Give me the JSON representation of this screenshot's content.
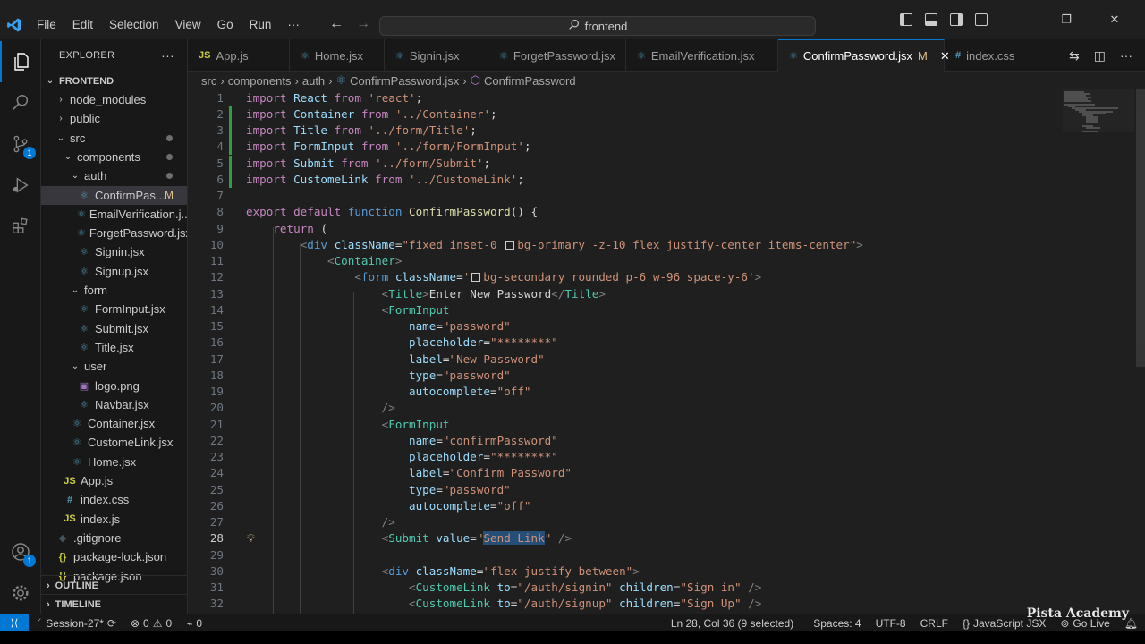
{
  "menu": [
    "File",
    "Edit",
    "Selection",
    "View",
    "Go",
    "Run",
    "···"
  ],
  "command_center": "frontend",
  "explorer": {
    "header": "EXPLORER",
    "more": "···",
    "root": "FRONTEND",
    "items": [
      {
        "label": "node_modules",
        "depth": 1,
        "kind": "folder-closed"
      },
      {
        "label": "public",
        "depth": 1,
        "kind": "folder-closed"
      },
      {
        "label": "src",
        "depth": 1,
        "kind": "folder-open",
        "dot": true
      },
      {
        "label": "components",
        "depth": 2,
        "kind": "folder-open",
        "dot": true
      },
      {
        "label": "auth",
        "depth": 3,
        "kind": "folder-open",
        "dot": true
      },
      {
        "label": "ConfirmPas...",
        "depth": 4,
        "kind": "react",
        "selected": true,
        "status": "M"
      },
      {
        "label": "EmailVerification.j...",
        "depth": 4,
        "kind": "react"
      },
      {
        "label": "ForgetPassword.jsx",
        "depth": 4,
        "kind": "react"
      },
      {
        "label": "Signin.jsx",
        "depth": 4,
        "kind": "react"
      },
      {
        "label": "Signup.jsx",
        "depth": 4,
        "kind": "react"
      },
      {
        "label": "form",
        "depth": 3,
        "kind": "folder-open"
      },
      {
        "label": "FormInput.jsx",
        "depth": 4,
        "kind": "react"
      },
      {
        "label": "Submit.jsx",
        "depth": 4,
        "kind": "react"
      },
      {
        "label": "Title.jsx",
        "depth": 4,
        "kind": "react"
      },
      {
        "label": "user",
        "depth": 3,
        "kind": "folder-open"
      },
      {
        "label": "logo.png",
        "depth": 4,
        "kind": "image"
      },
      {
        "label": "Navbar.jsx",
        "depth": 4,
        "kind": "react"
      },
      {
        "label": "Container.jsx",
        "depth": 3,
        "kind": "react"
      },
      {
        "label": "CustomeLink.jsx",
        "depth": 3,
        "kind": "react"
      },
      {
        "label": "Home.jsx",
        "depth": 3,
        "kind": "react"
      },
      {
        "label": "App.js",
        "depth": 2,
        "kind": "js"
      },
      {
        "label": "index.css",
        "depth": 2,
        "kind": "css"
      },
      {
        "label": "index.js",
        "depth": 2,
        "kind": "js"
      },
      {
        "label": ".gitignore",
        "depth": 1,
        "kind": "git"
      },
      {
        "label": "package-lock.json",
        "depth": 1,
        "kind": "json"
      },
      {
        "label": "package.json",
        "depth": 1,
        "kind": "json"
      }
    ],
    "outline": "OUTLINE",
    "timeline": "TIMELINE"
  },
  "tabs": [
    {
      "label": "App.js",
      "icon": "JS",
      "kind": "js"
    },
    {
      "label": "Home.jsx",
      "icon": "⚛",
      "kind": "react"
    },
    {
      "label": "Signin.jsx",
      "icon": "⚛",
      "kind": "react"
    },
    {
      "label": "ForgetPassword.jsx",
      "icon": "⚛",
      "kind": "react"
    },
    {
      "label": "EmailVerification.jsx",
      "icon": "⚛",
      "kind": "react"
    },
    {
      "label": "ConfirmPassword.jsx",
      "icon": "⚛",
      "kind": "react",
      "active": true,
      "status": "M",
      "close": "✕"
    },
    {
      "label": "index.css",
      "icon": "#",
      "kind": "css"
    }
  ],
  "breadcrumb": [
    "src",
    "components",
    "auth",
    "ConfirmPassword.jsx",
    "ConfirmPassword"
  ],
  "code": {
    "current_line": 28,
    "lines": [
      {
        "n": "1",
        "html": "<span class='kw'>import</span> <span class='id'>React</span> <span class='kw'>from</span> <span class='str'>'react'</span><span class='txt'>;</span>"
      },
      {
        "n": "2",
        "html": "<span class='kw'>import</span> <span class='id'>Container</span> <span class='kw'>from</span> <span class='str'>'../Container'</span><span class='txt'>;</span>",
        "mod": true
      },
      {
        "n": "3",
        "html": "<span class='kw'>import</span> <span class='id'>Title</span> <span class='kw'>from</span> <span class='str'>'../form/Title'</span><span class='txt'>;</span>",
        "mod": true
      },
      {
        "n": "4",
        "html": "<span class='kw'>import</span> <span class='id'>FormInput</span> <span class='kw'>from</span> <span class='str'>'../form/FormInput'</span><span class='txt'>;</span>",
        "mod": true
      },
      {
        "n": "5",
        "html": "<span class='kw'>import</span> <span class='id'>Submit</span> <span class='kw'>from</span> <span class='str'>'../form/Submit'</span><span class='txt'>;</span>",
        "mod": true
      },
      {
        "n": "6",
        "html": "<span class='kw'>import</span> <span class='id'>CustomeLink</span> <span class='kw'>from</span> <span class='str'>'../CustomeLink'</span><span class='txt'>;</span>",
        "mod": true
      },
      {
        "n": "7",
        "html": ""
      },
      {
        "n": "8",
        "html": "<span class='kw'>export</span> <span class='kw'>default</span> <span class='kw2'>function</span> <span class='fn'>ConfirmPassword</span><span class='txt'>() {</span>"
      },
      {
        "n": "9",
        "html": "    <span class='kw'>return</span> <span class='txt'>(</span>"
      },
      {
        "n": "10",
        "html": "        <span class='brk'>&lt;</span><span class='kw2'>div</span> <span class='attr'>className</span><span class='txt'>=</span><span class='str'>\"fixed inset-0 <span class='colorbox'></span>bg-primary -z-10 flex justify-center items-center\"</span><span class='brk'>&gt;</span>"
      },
      {
        "n": "11",
        "html": "            <span class='brk'>&lt;</span><span class='tag'>Container</span><span class='brk'>&gt;</span>"
      },
      {
        "n": "12",
        "html": "                <span class='brk'>&lt;</span><span class='kw2'>form</span> <span class='attr'>className</span><span class='txt'>=</span><span class='str'>'<span class='colorbox'></span>bg-secondary rounded p-6 w-96 space-y-6'</span><span class='brk'>&gt;</span>"
      },
      {
        "n": "13",
        "html": "                    <span class='brk'>&lt;</span><span class='tag'>Title</span><span class='brk'>&gt;</span><span class='txt'>Enter New Password</span><span class='brk'>&lt;/</span><span class='tag'>Title</span><span class='brk'>&gt;</span>"
      },
      {
        "n": "14",
        "html": "                    <span class='brk'>&lt;</span><span class='tag'>FormInput</span>"
      },
      {
        "n": "15",
        "html": "                        <span class='attr'>name</span><span class='txt'>=</span><span class='str'>\"password\"</span>"
      },
      {
        "n": "16",
        "html": "                        <span class='attr'>placeholder</span><span class='txt'>=</span><span class='str'>\"********\"</span>"
      },
      {
        "n": "17",
        "html": "                        <span class='attr'>label</span><span class='txt'>=</span><span class='str'>\"New Password\"</span>"
      },
      {
        "n": "18",
        "html": "                        <span class='attr'>type</span><span class='txt'>=</span><span class='str'>\"password\"</span>"
      },
      {
        "n": "19",
        "html": "                        <span class='attr'>autocomplete</span><span class='txt'>=</span><span class='str'>\"off\"</span>"
      },
      {
        "n": "20",
        "html": "                    <span class='brk'>/&gt;</span>"
      },
      {
        "n": "21",
        "html": "                    <span class='brk'>&lt;</span><span class='tag'>FormInput</span>"
      },
      {
        "n": "22",
        "html": "                        <span class='attr'>name</span><span class='txt'>=</span><span class='str'>\"confirmPassword\"</span>"
      },
      {
        "n": "23",
        "html": "                        <span class='attr'>placeholder</span><span class='txt'>=</span><span class='str'>\"********\"</span>"
      },
      {
        "n": "24",
        "html": "                        <span class='attr'>label</span><span class='txt'>=</span><span class='str'>\"Confirm Password\"</span>"
      },
      {
        "n": "25",
        "html": "                        <span class='attr'>type</span><span class='txt'>=</span><span class='str'>\"password\"</span>"
      },
      {
        "n": "26",
        "html": "                        <span class='attr'>autocomplete</span><span class='txt'>=</span><span class='str'>\"off\"</span>"
      },
      {
        "n": "27",
        "html": "                    <span class='brk'>/&gt;</span>"
      },
      {
        "n": "28",
        "html": "                    <span class='brk'>&lt;</span><span class='tag'>Submit</span> <span class='attr'>value</span><span class='txt'>=</span><span class='str'>\"<span class='sel'>Send Link</span>\"</span> <span class='brk'>/&gt;</span>",
        "bulb": true
      },
      {
        "n": "29",
        "html": ""
      },
      {
        "n": "30",
        "html": "                    <span class='brk'>&lt;</span><span class='kw2'>div</span> <span class='attr'>className</span><span class='txt'>=</span><span class='str'>\"flex justify-between\"</span><span class='brk'>&gt;</span>"
      },
      {
        "n": "31",
        "html": "                        <span class='brk'>&lt;</span><span class='tag'>CustomeLink</span> <span class='attr'>to</span><span class='txt'>=</span><span class='str'>\"/auth/signin\"</span> <span class='attr'>children</span><span class='txt'>=</span><span class='str'>\"Sign in\"</span> <span class='brk'>/&gt;</span>"
      },
      {
        "n": "32",
        "html": "                        <span class='brk'>&lt;</span><span class='tag'>CustomeLink</span> <span class='attr'>to</span><span class='txt'>=</span><span class='str'>\"/auth/signup\"</span> <span class='attr'>children</span><span class='txt'>=</span><span class='str'>\"Sign Up\"</span> <span class='brk'>/&gt;</span>"
      }
    ]
  },
  "status": {
    "branch": "Session-27*",
    "errors": "0",
    "warnings": "0",
    "ports": "0",
    "position": "Ln 28, Col 36 (9 selected)",
    "spaces": "Spaces: 4",
    "encoding": "UTF-8",
    "eol": "CRLF",
    "language": "JavaScript JSX",
    "golive": "Go Live"
  },
  "watermark": "Pista Academy",
  "colors": {
    "accent": "#0078d4",
    "modified": "#e2c08d",
    "react": "#519aba",
    "js": "#cbcb41"
  }
}
